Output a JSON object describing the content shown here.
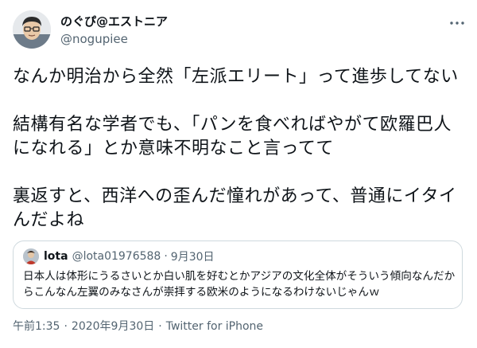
{
  "author": {
    "display_name": "のぐぴ@エストニア",
    "handle": "@nogupiee"
  },
  "tweet": {
    "paragraphs": [
      "なんか明治から全然「左派エリート」って進歩してない",
      "結構有名な学者でも、「パンを食べればやがて欧羅巴人になれる」とか意味不明なこと言ってて",
      "裏返すと、西洋への歪んだ憧れがあって、普通にイタイんだよね"
    ]
  },
  "quoted": {
    "name": "lota",
    "handle": "@lota01976588",
    "separator": "·",
    "date": "9月30日",
    "text": "日本人は体形にうるさいとか白い肌を好むとかアジアの文化全体がそういう傾向なんだからこんなん左翼のみなさんが崇拝する欧米のようになるわけないじゃんｗ"
  },
  "meta": {
    "time": "午前1:35",
    "separator": "·",
    "date": "2020年9月30日",
    "source": "Twitter for iPhone"
  },
  "icons": {
    "more": "more-horizontal-icon"
  },
  "colors": {
    "text": "#0f1419",
    "secondary": "#536471",
    "border": "#cfd9de"
  }
}
